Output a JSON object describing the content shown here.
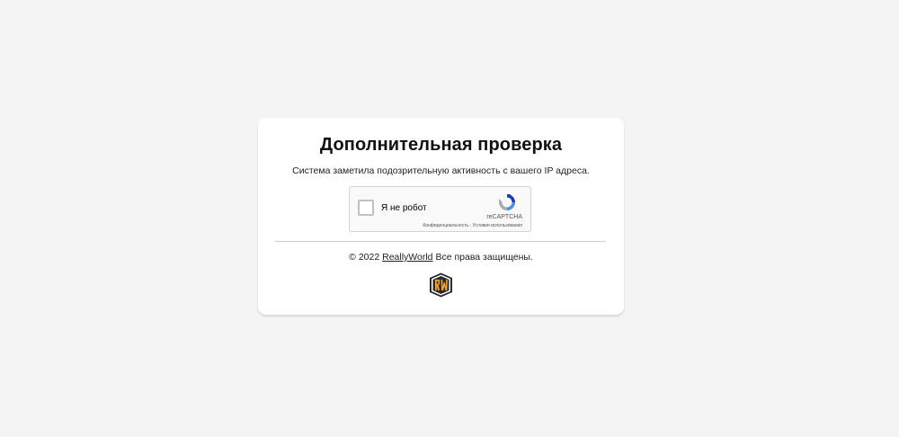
{
  "verification": {
    "title": "Дополнительная проверка",
    "subtitle": "Система заметила подозрительную активность с вашего IP адреса."
  },
  "recaptcha": {
    "checkbox_label": "Я не робот",
    "brand": "reCAPTCHA",
    "privacy_link": "Конфиденциальность",
    "separator": " - ",
    "terms_link": "Условия использования",
    "icon": "recaptcha-logo-icon"
  },
  "footer": {
    "copyright_prefix": "© 2022",
    "brand_link": "ReallyWorld",
    "rights_text": "Все права защищены."
  },
  "logo": {
    "icon": "reallyworld-logo-icon",
    "colors": {
      "primary": "#f5a623",
      "dark": "#2b2b2b"
    }
  }
}
